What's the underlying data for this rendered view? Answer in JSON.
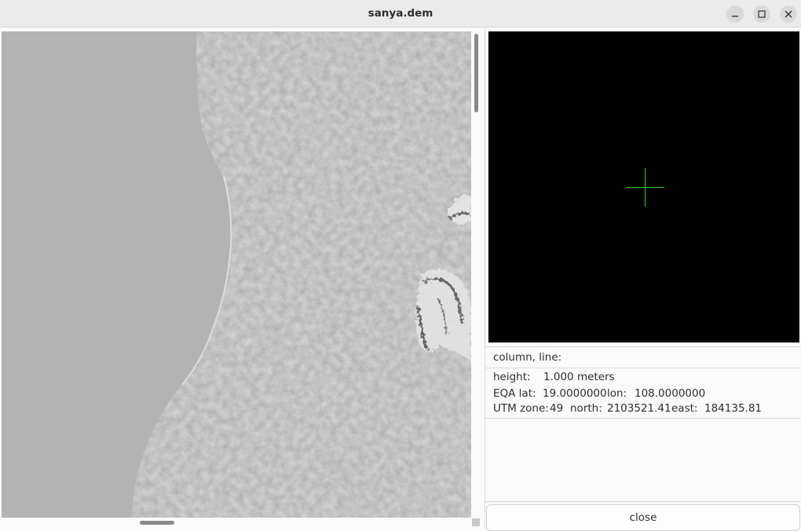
{
  "window": {
    "title": "sanya.dem"
  },
  "info": {
    "column_line": "column, line:",
    "height_label": "height:",
    "height_value": "1.000 meters",
    "eqa_lat_label": "EQA lat:",
    "eqa_lat_value": "19.0000000",
    "lon_label": "lon:",
    "lon_value": "108.0000000",
    "utm_zone_label": "UTM zone:",
    "utm_zone_value": "49",
    "north_label": "north:",
    "north_value": "2103521.41",
    "east_label": "east:",
    "east_value": "184135.81"
  },
  "buttons": {
    "close_label": "close"
  },
  "colors": {
    "crosshair": "#2bd12b",
    "overview_bg": "#000000",
    "sea": "#b3b3b3"
  }
}
